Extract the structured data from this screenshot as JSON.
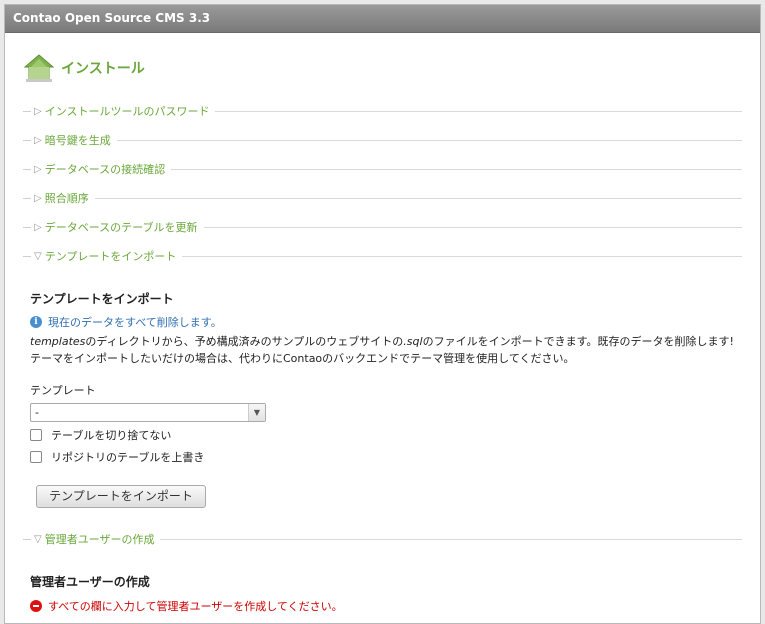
{
  "window": {
    "title": "Contao Open Source CMS 3.3"
  },
  "heading": {
    "title": "インストール"
  },
  "sections": [
    {
      "label": "インストールツールのパスワード",
      "expanded": false
    },
    {
      "label": "暗号鍵を生成",
      "expanded": false
    },
    {
      "label": "データベースの接続確認",
      "expanded": false
    },
    {
      "label": "照合順序",
      "expanded": false
    },
    {
      "label": "データベースのテーブルを更新",
      "expanded": false
    },
    {
      "label": "テンプレートをインポート",
      "expanded": true
    },
    {
      "label": "管理者ユーザーの作成",
      "expanded": true
    }
  ],
  "import_form": {
    "title": "テンプレートをインポート",
    "info": "現在のデータをすべて削除します。",
    "desc_em1": "templates",
    "desc_part1": "のディレクトリから、予め構成済みのサンプルのウェブサイトの",
    "desc_em2": ".sql",
    "desc_part2": "のファイルをインポートできます。既存のデータを削除します!",
    "desc_line2": "テーマをインポートしたいだけの場合は、代わりにContaoのバックエンドでテーマ管理を使用してください。",
    "template_label": "テンプレート",
    "template_value": "-",
    "checkbox_truncate": "テーブルを切り捨てない",
    "checkbox_overwrite": "リポジトリのテーブルを上書き",
    "button_label": "テンプレートをインポート"
  },
  "admin_form": {
    "title": "管理者ユーザーの作成",
    "error": "すべての欄に入力して管理者ユーザーを作成してください。"
  },
  "colors": {
    "accent": "#6aa73b",
    "info": "#2f6fb0",
    "error": "#cc0000",
    "titlebar": "#8a8a8a"
  }
}
